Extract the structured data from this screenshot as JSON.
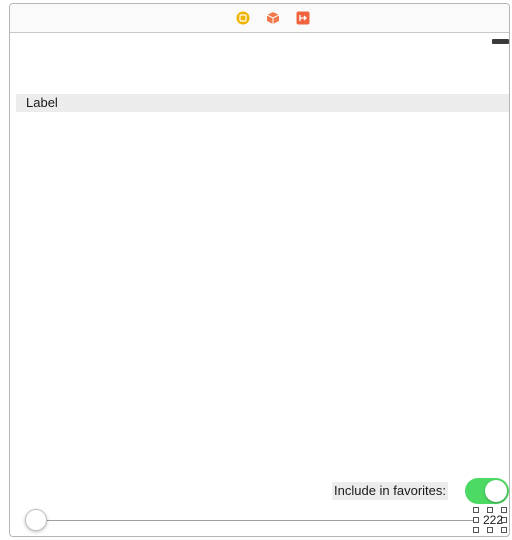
{
  "scene_dock": {
    "icons": [
      "view-controller-icon",
      "first-responder-icon",
      "exit-icon"
    ],
    "colors": {
      "view_controller": "#f0b400",
      "first_responder": "#f0784a",
      "exit": "#f06440"
    }
  },
  "canvas": {
    "label_text": "Label",
    "favorites_label": "Include in favorites:",
    "favorites_toggle_on": true,
    "toggle_color": "#4cd964",
    "slider_value": 0,
    "counter_value": "222"
  }
}
